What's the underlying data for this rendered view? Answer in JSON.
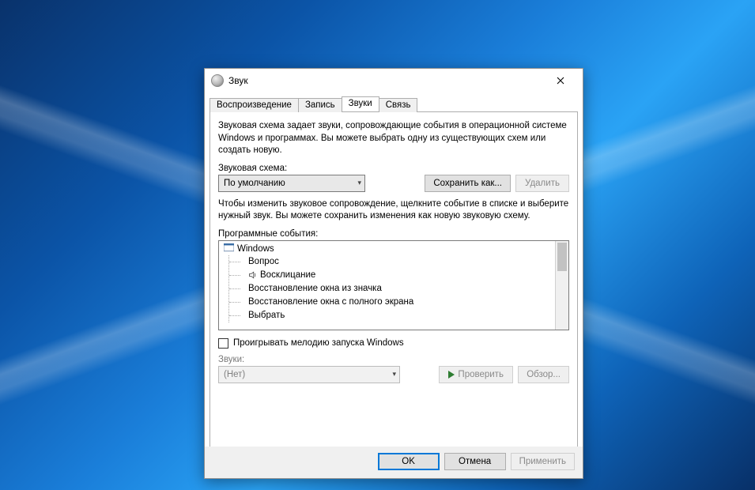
{
  "window": {
    "title": "Звук"
  },
  "tabs": {
    "playback": "Воспроизведение",
    "record": "Запись",
    "sounds": "Звуки",
    "comm": "Связь"
  },
  "desc1": "Звуковая схема задает звуки, сопровождающие события в операционной системе Windows и программах. Вы можете выбрать одну из существующих схем или создать новую.",
  "scheme_label": "Звуковая схема:",
  "scheme_value": "По умолчанию",
  "save_as": "Сохранить как...",
  "delete": "Удалить",
  "desc2": "Чтобы изменить звуковое сопровождение, щелкните событие в списке и выберите нужный звук. Вы можете сохранить изменения как новую звуковую схему.",
  "events_label": "Программные события:",
  "tree": {
    "root": "Windows",
    "items": [
      {
        "label": "Вопрос",
        "has_sound": false
      },
      {
        "label": "Восклицание",
        "has_sound": true
      },
      {
        "label": "Восстановление окна из значка",
        "has_sound": false
      },
      {
        "label": "Восстановление окна с полного экрана",
        "has_sound": false
      },
      {
        "label": "Выбрать",
        "has_sound": false
      }
    ]
  },
  "startup_checkbox": "Проигрывать мелодию запуска Windows",
  "sounds_label": "Звуки:",
  "sounds_value": "(Нет)",
  "test": "Проверить",
  "browse": "Обзор...",
  "footer": {
    "ok": "OK",
    "cancel": "Отмена",
    "apply": "Применить"
  }
}
